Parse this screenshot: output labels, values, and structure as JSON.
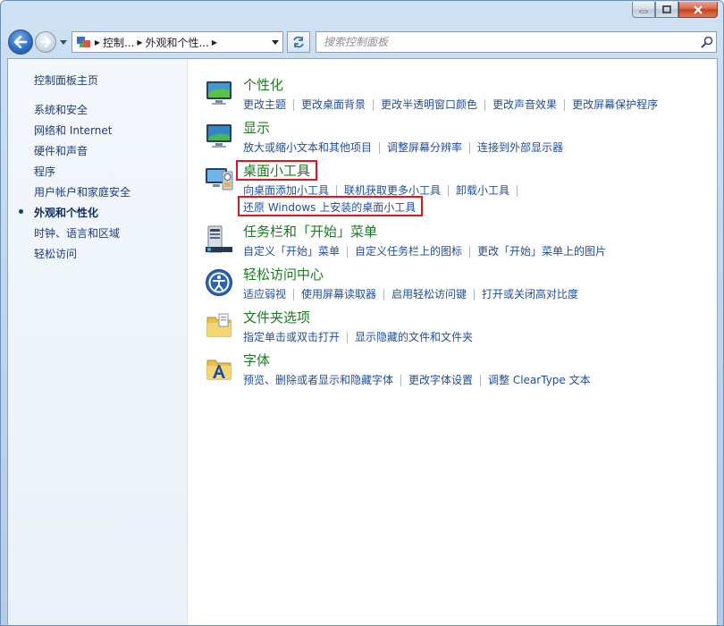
{
  "window": {
    "colors": {
      "title_green": "#1b7a1f",
      "link_blue": "#1f4d9c",
      "highlight_red": "#e2151f"
    }
  },
  "address": {
    "crumbs": [
      "控制...",
      "外观和个性..."
    ],
    "search_placeholder": "搜索控制面板"
  },
  "sidebar": {
    "home": "控制面板主页",
    "items": [
      "系统和安全",
      "网络和 Internet",
      "硬件和声音",
      "程序",
      "用户帐户和家庭安全",
      "外观和个性化",
      "时钟、语言和区域",
      "轻松访问"
    ],
    "current_index": 5
  },
  "categories": [
    {
      "title": "个性化",
      "icon": "personalization-icon",
      "links": [
        "更改主题",
        "更改桌面背景",
        "更改半透明窗口颜色",
        "更改声音效果",
        "更改屏幕保护程序"
      ]
    },
    {
      "title": "显示",
      "icon": "display-icon",
      "links": [
        "放大或缩小文本和其他项目",
        "调整屏幕分辨率",
        "连接到外部显示器"
      ]
    },
    {
      "title": "桌面小工具",
      "icon": "gadgets-icon",
      "links": [
        "向桌面添加小工具",
        "联机获取更多小工具",
        "卸载小工具"
      ],
      "links2": [
        "还原 Windows 上安装的桌面小工具"
      ]
    },
    {
      "title": "任务栏和「开始」菜单",
      "icon": "taskbar-icon",
      "links": [
        "自定义「开始」菜单",
        "自定义任务栏上的图标",
        "更改「开始」菜单上的图片"
      ]
    },
    {
      "title": "轻松访问中心",
      "icon": "ease-of-access-icon",
      "links": [
        "适应弱视",
        "使用屏幕读取器",
        "启用轻松访问键",
        "打开或关闭高对比度"
      ]
    },
    {
      "title": "文件夹选项",
      "icon": "folder-options-icon",
      "links": [
        "指定单击或双击打开",
        "显示隐藏的文件和文件夹"
      ]
    },
    {
      "title": "字体",
      "icon": "fonts-icon",
      "links": [
        "预览、删除或者显示和隐藏字体",
        "更改字体设置",
        "调整 ClearType 文本"
      ]
    }
  ]
}
